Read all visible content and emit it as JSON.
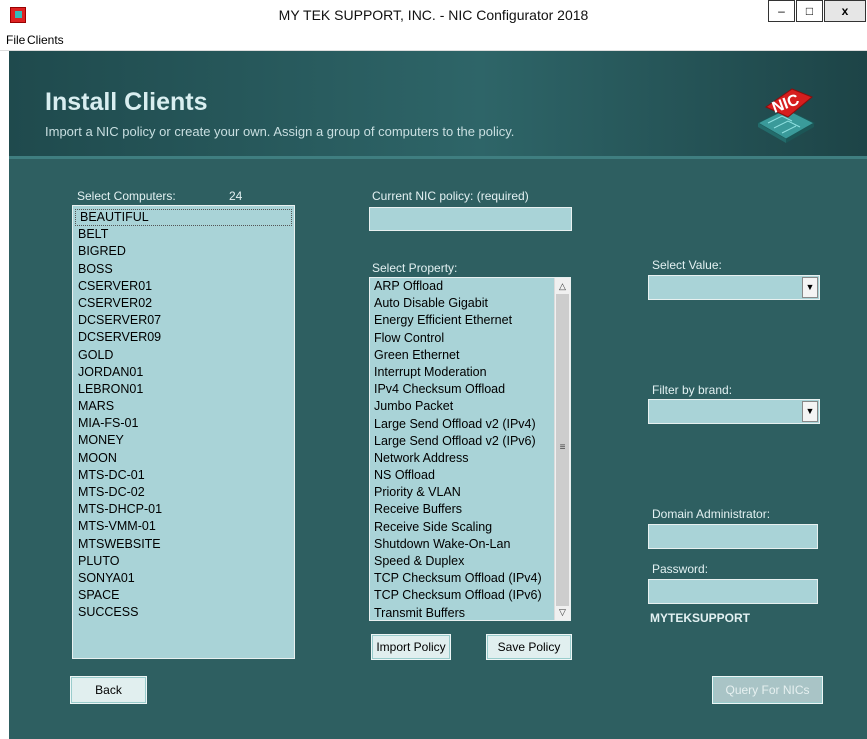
{
  "window": {
    "title": "MY TEK SUPPORT, INC. - NIC Configurator 2018",
    "minimize": "‒",
    "maximize": "□",
    "close": "x"
  },
  "menu": {
    "file": "File",
    "clients": "Clients"
  },
  "header": {
    "title": "Install Clients",
    "subtitle": "Import a NIC policy or create your own.  Assign a group of computers to the policy.",
    "logo_text": "NIC"
  },
  "computers": {
    "label": "Select Computers:",
    "count": "24",
    "items": [
      "BEAUTIFUL",
      "BELT",
      "BIGRED",
      "BOSS",
      "CSERVER01",
      "CSERVER02",
      "DCSERVER07",
      "DCSERVER09",
      "GOLD",
      "JORDAN01",
      "LEBRON01",
      "MARS",
      "MIA-FS-01",
      "MONEY",
      "MOON",
      "MTS-DC-01",
      "MTS-DC-02",
      "MTS-DHCP-01",
      "MTS-VMM-01",
      "MTSWEBSITE",
      "PLUTO",
      "SONYA01",
      "SPACE",
      "SUCCESS"
    ]
  },
  "policy": {
    "label": "Current NIC policy: (required)",
    "value": ""
  },
  "properties": {
    "label": "Select Property:",
    "items": [
      "ARP Offload",
      "Auto Disable Gigabit",
      "Energy Efficient Ethernet",
      "Flow Control",
      "Green Ethernet",
      "Interrupt Moderation",
      "IPv4 Checksum Offload",
      "Jumbo Packet",
      "Large Send Offload v2 (IPv4)",
      "Large Send Offload v2 (IPv6)",
      "Network Address",
      "NS Offload",
      "Priority & VLAN",
      "Receive Buffers",
      "Receive Side Scaling",
      "Shutdown Wake-On-Lan",
      "Speed & Duplex",
      "TCP Checksum Offload (IPv4)",
      "TCP Checksum Offload (IPv6)",
      "Transmit Buffers"
    ]
  },
  "value": {
    "label": "Select Value:",
    "selected": ""
  },
  "brand": {
    "label": "Filter by brand:",
    "selected": ""
  },
  "admin": {
    "label": "Domain Administrator:",
    "value": ""
  },
  "password": {
    "label": "Password:",
    "value": ""
  },
  "domain": "MYTEKSUPPORT",
  "buttons": {
    "import_policy": "Import Policy",
    "save_policy": "Save Policy",
    "back": "Back",
    "query": "Query For NICs"
  },
  "colors": {
    "background": "#2e5f61",
    "field": "#a9d3d7",
    "text_light": "#e3f1f2"
  }
}
